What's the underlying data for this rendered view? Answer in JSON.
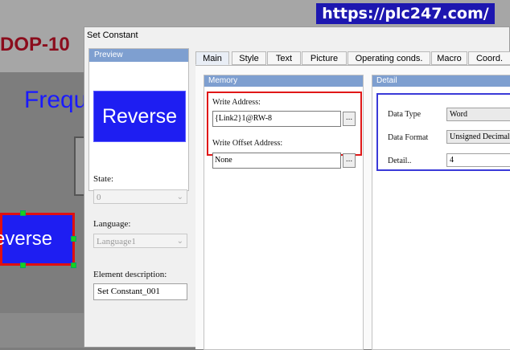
{
  "background": {
    "title_fragment": "DOP-10",
    "freq_fragment": "Frequ",
    "reverse_fragment": "everse",
    "url_banner": "https://plc247.com/"
  },
  "dialog": {
    "title": "Set Constant",
    "preview": {
      "header": "Preview",
      "button_label": "Reverse"
    },
    "state": {
      "label": "State:",
      "value": "0"
    },
    "language": {
      "label": "Language:",
      "value": "Language1"
    },
    "element_description": {
      "label": "Element description:",
      "value": "Set Constant_001"
    },
    "tabs": [
      "Main",
      "Style",
      "Text",
      "Picture",
      "Operating conds.",
      "Macro",
      "Coord."
    ],
    "active_tab": "Main",
    "memory": {
      "header": "Memory",
      "write_address_label": "Write Address:",
      "write_address_value": "{Link2}1@RW-8",
      "write_offset_label": "Write Offset Address:",
      "write_offset_value": "None",
      "browse_label": "..."
    },
    "detail": {
      "header": "Detail",
      "data_type_label": "Data Type",
      "data_type_value": "Word",
      "data_format_label": "Data Format",
      "data_format_value": "Unsigned Decimal",
      "detail_label": "Detail..",
      "detail_value": "4"
    },
    "colors": {
      "accent_header": "#7e9fd0",
      "button_blue": "#1e1ef2",
      "highlight_red": "#e01818",
      "highlight_blue": "#3a3ad8"
    }
  }
}
